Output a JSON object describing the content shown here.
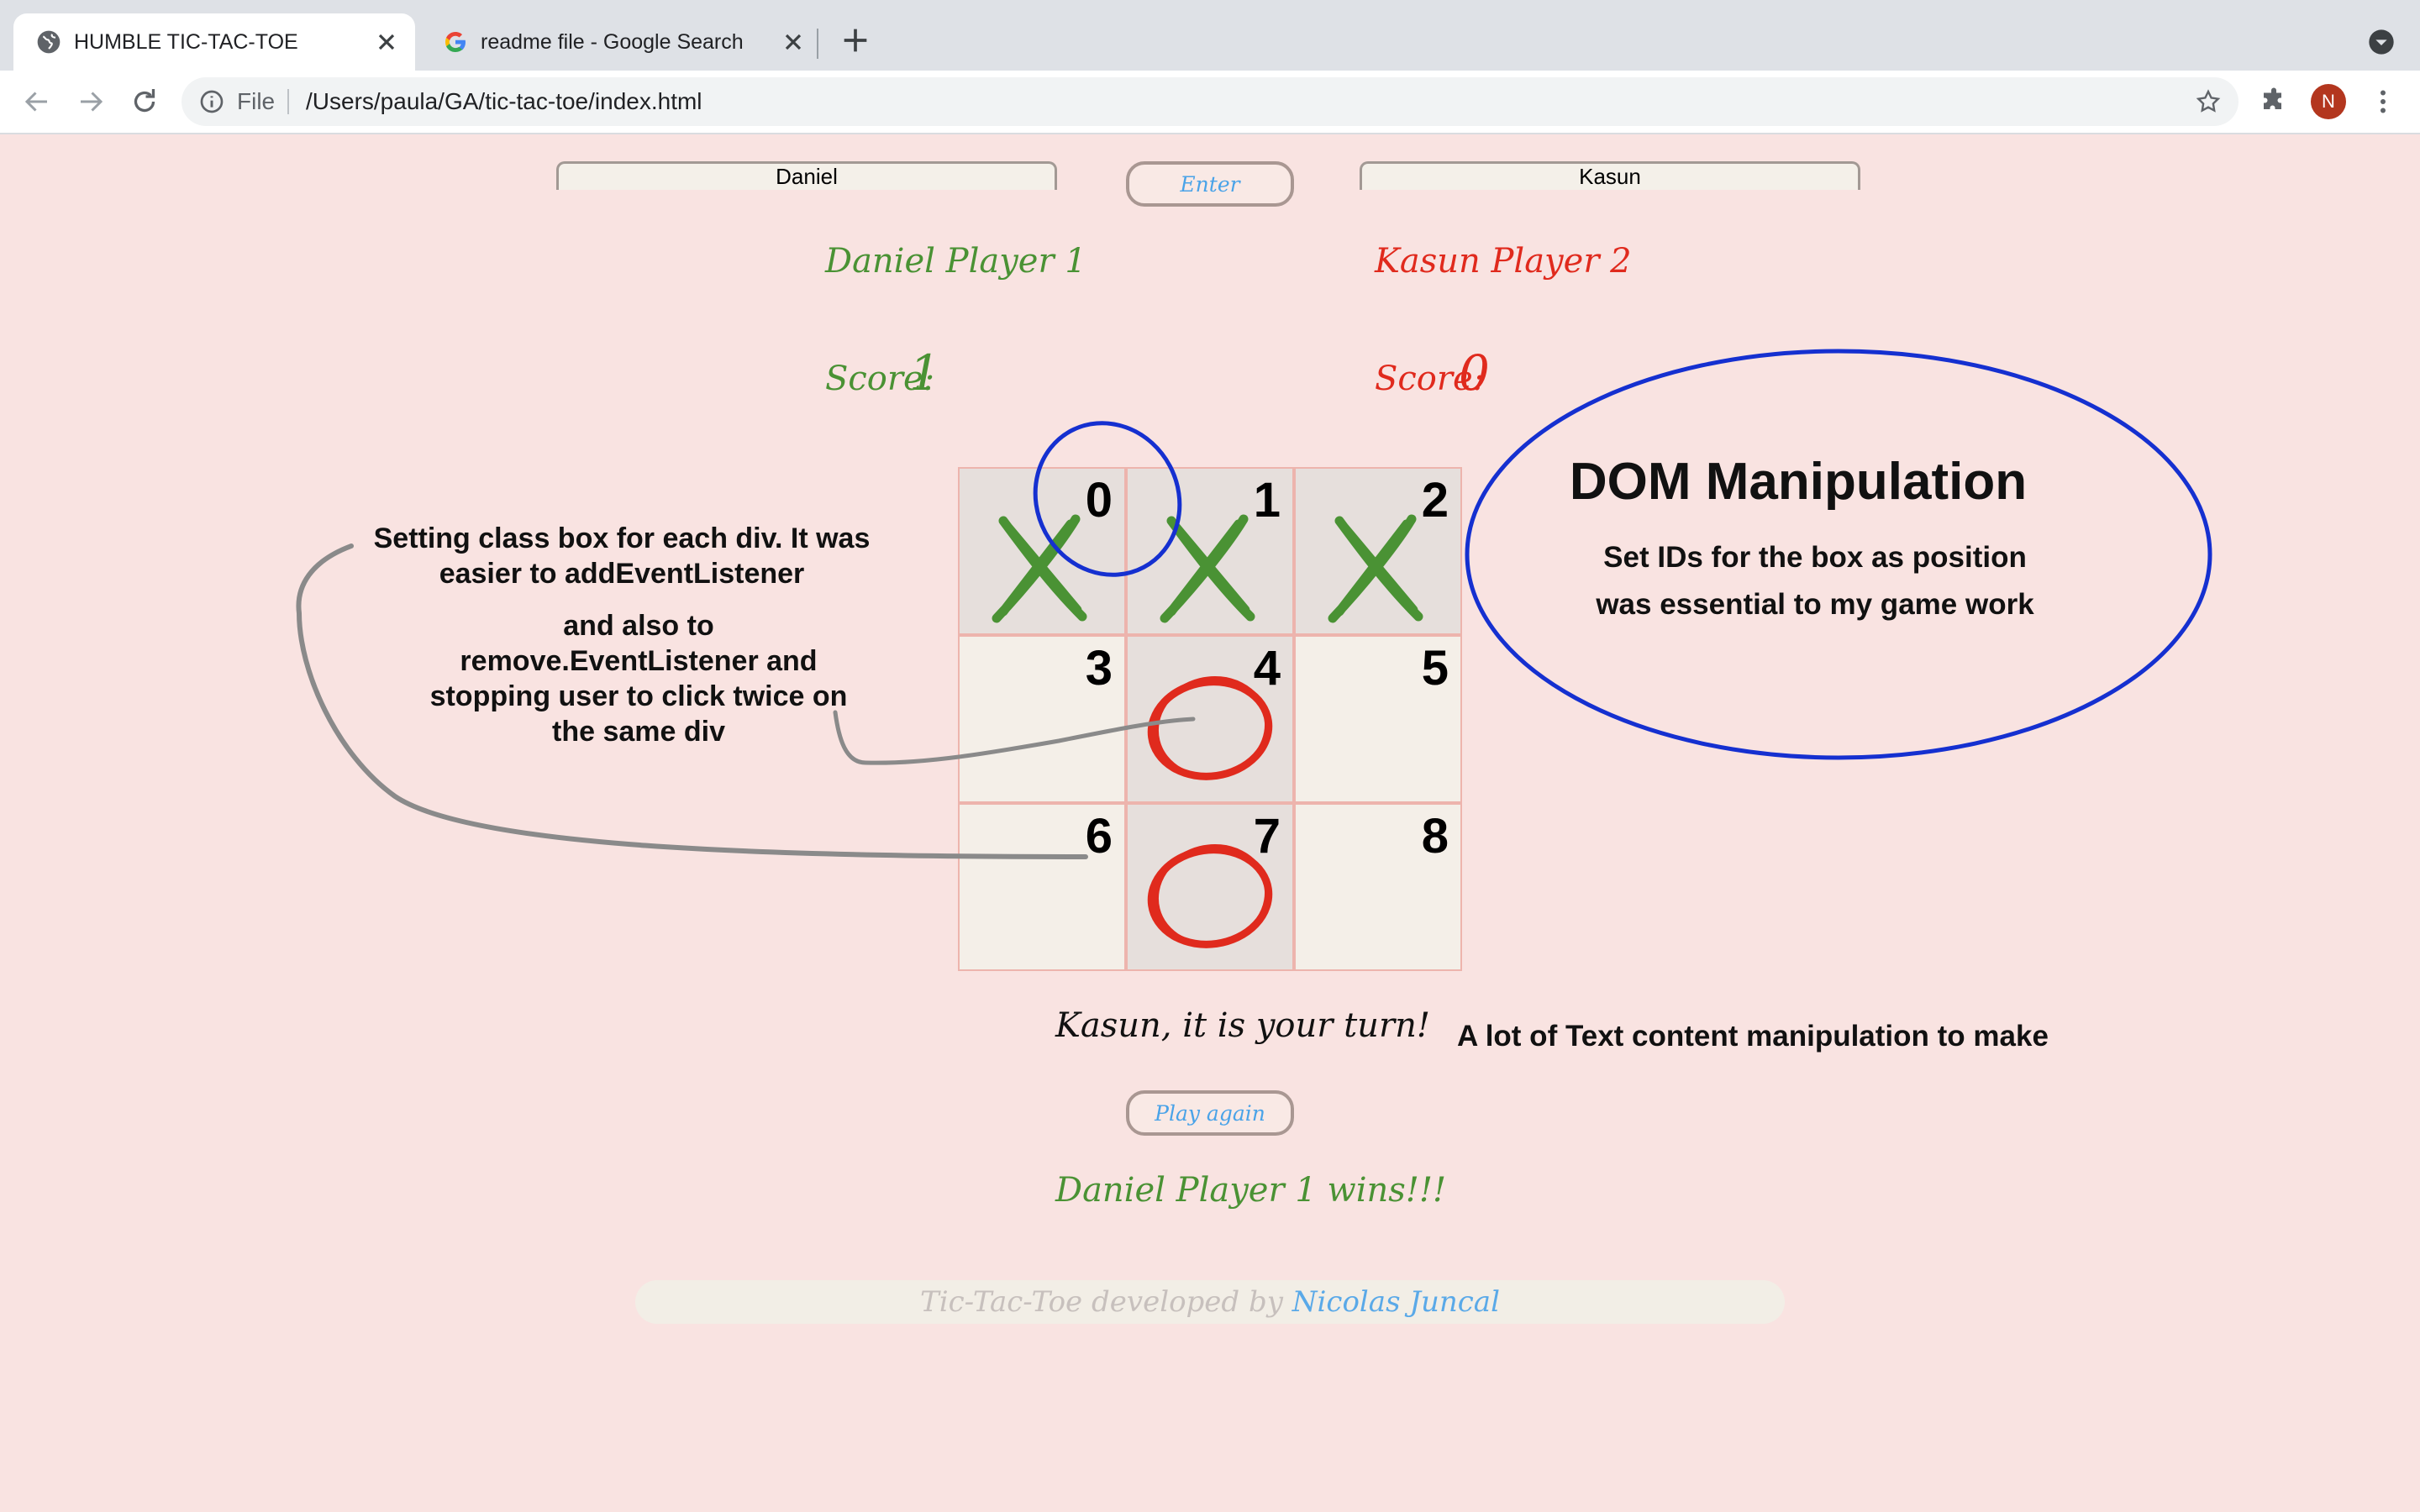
{
  "browser": {
    "tabs": [
      {
        "title": "HUMBLE TIC-TAC-TOE",
        "active": true,
        "icon": "globe-icon"
      },
      {
        "title": "readme file - Google Search",
        "active": false,
        "icon": "google-icon"
      }
    ],
    "omnibox": {
      "scheme_label": "File",
      "url": "/Users/paula/GA/tic-tac-toe/index.html"
    },
    "profile_initial": "N"
  },
  "game": {
    "player1_input": "Daniel",
    "player2_input": "Kasun",
    "enter_label": "Enter",
    "player1_label": "Daniel Player 1",
    "player2_label": "Kasun Player 2",
    "score_label": "Score:",
    "player1_score": "1",
    "player2_score": "0",
    "cells": [
      {
        "num": "0",
        "mark": "X"
      },
      {
        "num": "1",
        "mark": "X"
      },
      {
        "num": "2",
        "mark": "X"
      },
      {
        "num": "3",
        "mark": ""
      },
      {
        "num": "4",
        "mark": "O"
      },
      {
        "num": "5",
        "mark": ""
      },
      {
        "num": "6",
        "mark": ""
      },
      {
        "num": "7",
        "mark": "O"
      },
      {
        "num": "8",
        "mark": ""
      }
    ],
    "turn_message": "Kasun, it is your turn!",
    "play_again_label": "Play again",
    "winner_message": "Daniel Player 1 wins!!!",
    "footer_text": "Tic-Tac-Toe developed by",
    "footer_link": "Nicolas Juncal"
  },
  "annotations": {
    "left_line1": "Setting class box for each div. It was",
    "left_line2": "easier to addEventListener",
    "mid_line1": "and also to",
    "mid_line2": "remove.EventListener and",
    "mid_line3": "stopping user to click twice on",
    "mid_line4": "the same div",
    "dom_title": "DOM Manipulation",
    "dom_line1": "Set IDs for the box as position",
    "dom_line2": "was essential to my game work",
    "text_note": "A lot of Text content manipulation to make"
  },
  "colors": {
    "page_bg": "#f9e3e1",
    "player1": "#4a9234",
    "player2": "#e02a1d",
    "annotation_blue": "#1530d0",
    "annotation_gray": "#8a8a8a"
  }
}
